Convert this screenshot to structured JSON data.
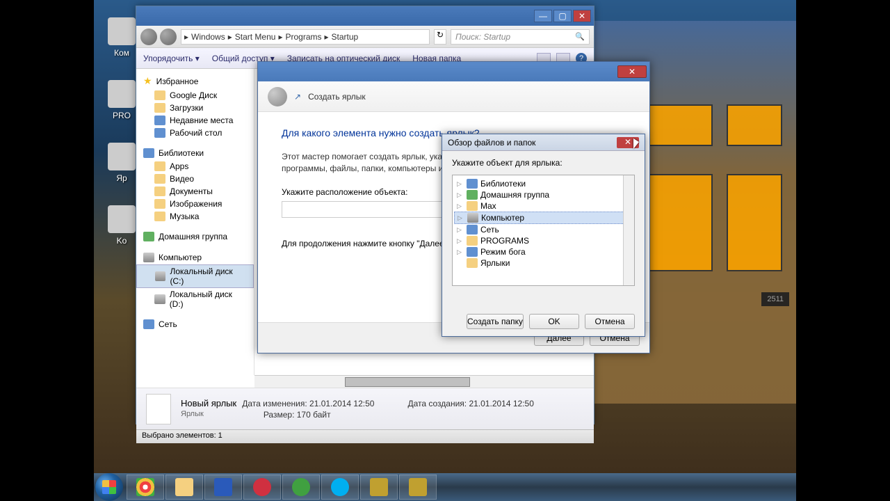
{
  "desktop_icons": [
    "Ком",
    "PRO",
    "Яр",
    "Ko"
  ],
  "house_number": "2511",
  "explorer": {
    "breadcrumb": [
      "Windows",
      "Start Menu",
      "Programs",
      "Startup"
    ],
    "search_placeholder": "Поиск: Startup",
    "toolbar": {
      "organize": "Упорядочить ▾",
      "share": "Общий доступ ▾",
      "burn": "Записать на оптический диск",
      "newfolder": "Новая папка"
    },
    "sidebar": {
      "favorites": "Избранное",
      "fav_items": [
        "Google Диск",
        "Загрузки",
        "Недавние места",
        "Рабочий стол"
      ],
      "libraries": "Библиотеки",
      "lib_items": [
        "Apps",
        "Видео",
        "Документы",
        "Изображения",
        "Музыка"
      ],
      "homegroup": "Домашняя группа",
      "computer": "Компьютер",
      "drives": [
        "Локальный диск (C:)",
        "Локальный диск (D:)"
      ],
      "network": "Сеть"
    },
    "details": {
      "name": "Новый ярлык",
      "type": "Ярлык",
      "date_mod_label": "Дата изменения:",
      "date_mod": "21.01.2014 12:50",
      "date_created_label": "Дата создания:",
      "date_created": "21.01.2014 12:50",
      "size_label": "Размер:",
      "size": "170 байт"
    },
    "status": "Выбрано элементов: 1"
  },
  "wizard": {
    "title": "Создать ярлык",
    "question": "Для какого элемента нужно создать ярлык?",
    "desc": "Этот мастер помогает создать ярлык, указывающий на локальные или сетевые программы, файлы, папки, компьютеры или адреса в Интернете.",
    "loc_label": "Укажите расположение объекта:",
    "hint": "Для продолжения нажмите кнопку \"Далее\".",
    "next": "Далее",
    "cancel": "Отмена"
  },
  "browse": {
    "title": "Обзор файлов и папок",
    "label": "Укажите объект для ярлыка:",
    "items": [
      "Библиотеки",
      "Домашняя группа",
      "Max",
      "Компьютер",
      "Сеть",
      "PROGRAMS",
      "Режим бога",
      "Ярлыки"
    ],
    "selected_index": 3,
    "newfolder": "Создать папку",
    "ok": "OK",
    "cancel": "Отмена"
  }
}
